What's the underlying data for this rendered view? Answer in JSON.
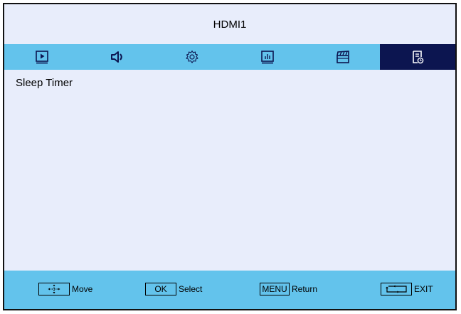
{
  "header": {
    "title": "HDMI1"
  },
  "tabs": [
    {
      "icon": "picture-icon",
      "active": false
    },
    {
      "icon": "speaker-icon",
      "active": false
    },
    {
      "icon": "gear-icon",
      "active": false
    },
    {
      "icon": "bar-chart-icon",
      "active": false
    },
    {
      "icon": "clapperboard-icon",
      "active": false
    },
    {
      "icon": "timer-document-icon",
      "active": true
    }
  ],
  "menu": {
    "items": [
      {
        "label": "Sleep Timer"
      }
    ]
  },
  "footer": {
    "move": {
      "key": "move-arrows-icon",
      "label": "Move"
    },
    "select": {
      "key": "OK",
      "label": "Select"
    },
    "return": {
      "key": "MENU",
      "label": "Return"
    },
    "exit": {
      "key": "exit-icon",
      "label": "EXIT"
    }
  },
  "colors": {
    "background": "#e8edfb",
    "bar": "#63c3ec",
    "active_tab": "#0c1550"
  }
}
